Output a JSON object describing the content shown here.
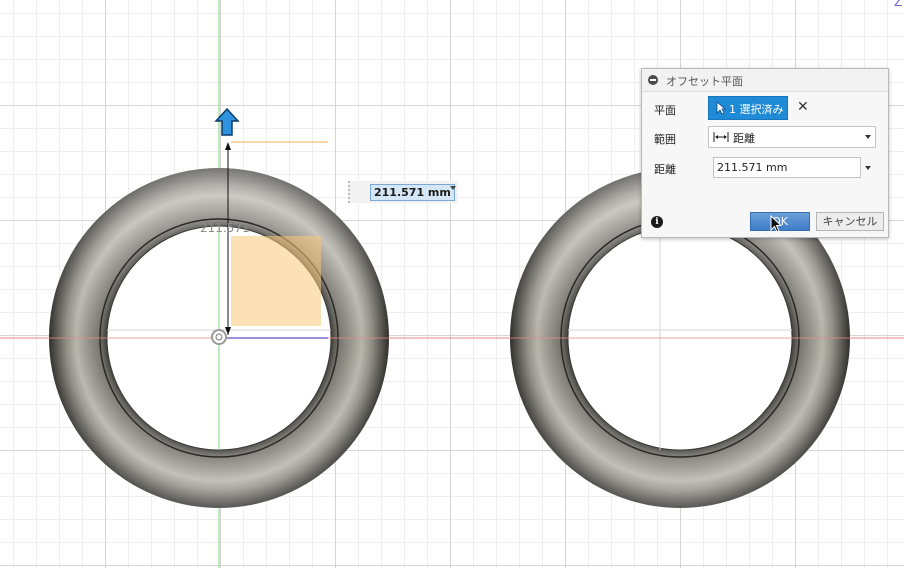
{
  "viewport": {
    "dimension_input_value": "211.571 mm",
    "dimension_label": "211.571",
    "corner_label": "Z"
  },
  "dialog": {
    "title": "オフセット平面",
    "plane": {
      "label": "平面",
      "selection_button": "1 選択済み"
    },
    "extent": {
      "label": "範囲",
      "value": "距離"
    },
    "distance": {
      "label": "距離",
      "value": "211.571 mm"
    },
    "ok_label": "OK",
    "cancel_label": "キャンセル"
  },
  "colors": {
    "accent_blue": "#1f8ad6",
    "x_axis": "#e06666",
    "y_axis": "#66cc66",
    "plane_preview": "#f9c97a"
  },
  "icons": [
    "collapse-icon",
    "pointer-icon",
    "close-icon",
    "distance-icon",
    "info-icon",
    "manipulator-arrow-icon",
    "origin-icon"
  ]
}
